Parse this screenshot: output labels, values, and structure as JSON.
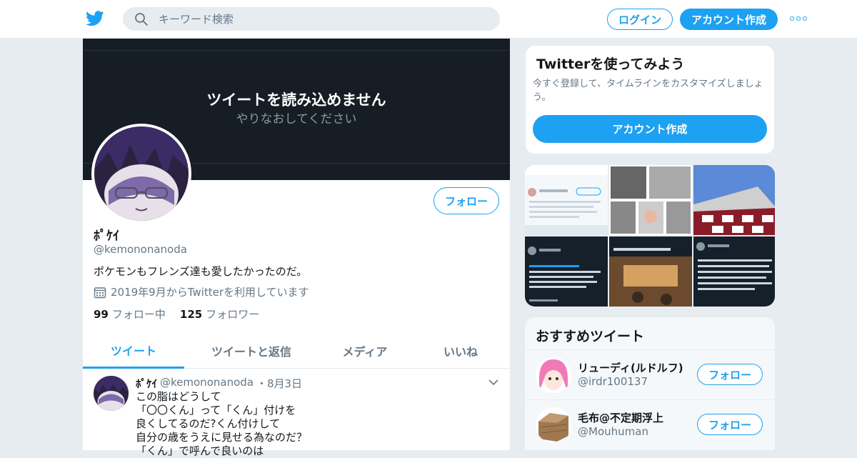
{
  "header": {
    "search_placeholder": "キーワード検索",
    "login_label": "ログイン",
    "signup_label": "アカウント作成"
  },
  "banner": {
    "title": "ツイートを読み込めません",
    "subtitle": "やりなおしてください"
  },
  "profile": {
    "name": "ﾎﾟｹｲ",
    "handle": "@kemononanoda",
    "bio": "ポケモンもフレンズ達も愛したかったのだ。",
    "joined": "2019年9月からTwitterを利用しています",
    "following_count": "99",
    "following_label": "フォロー中",
    "followers_count": "125",
    "followers_label": "フォロワー",
    "follow_label": "フォロー"
  },
  "tabs": [
    "ツイート",
    "ツイートと返信",
    "メディア",
    "いいね"
  ],
  "tweet": {
    "name": "ﾎﾟｹｲ",
    "handle": "@kemononanoda",
    "date": "・8月3日",
    "text": "この脂はどうして\n「〇〇くん」って「くん」付けを\n良くしてるのだ?くん付けして\n自分の歳をうえに見せる為なのだ？\n「くん」で呼んで良いのは"
  },
  "signup_box": {
    "title": "Twitterを使ってみよう",
    "text": "今すぐ登録して、タイムラインをカスタマイズしましょう。",
    "button": "アカウント作成"
  },
  "recommend": {
    "title": "おすすめツイート",
    "users": [
      {
        "name": "リューディ(ルドルフ)",
        "handle": "@irdr100137",
        "follow": "フォロー"
      },
      {
        "name": "毛布@不定期浮上",
        "handle": "@Mouhuman",
        "follow": "フォロー"
      }
    ]
  },
  "colors": {
    "accent": "#1da1f2",
    "background": "#e6ecf0",
    "banner": "#161d24"
  }
}
